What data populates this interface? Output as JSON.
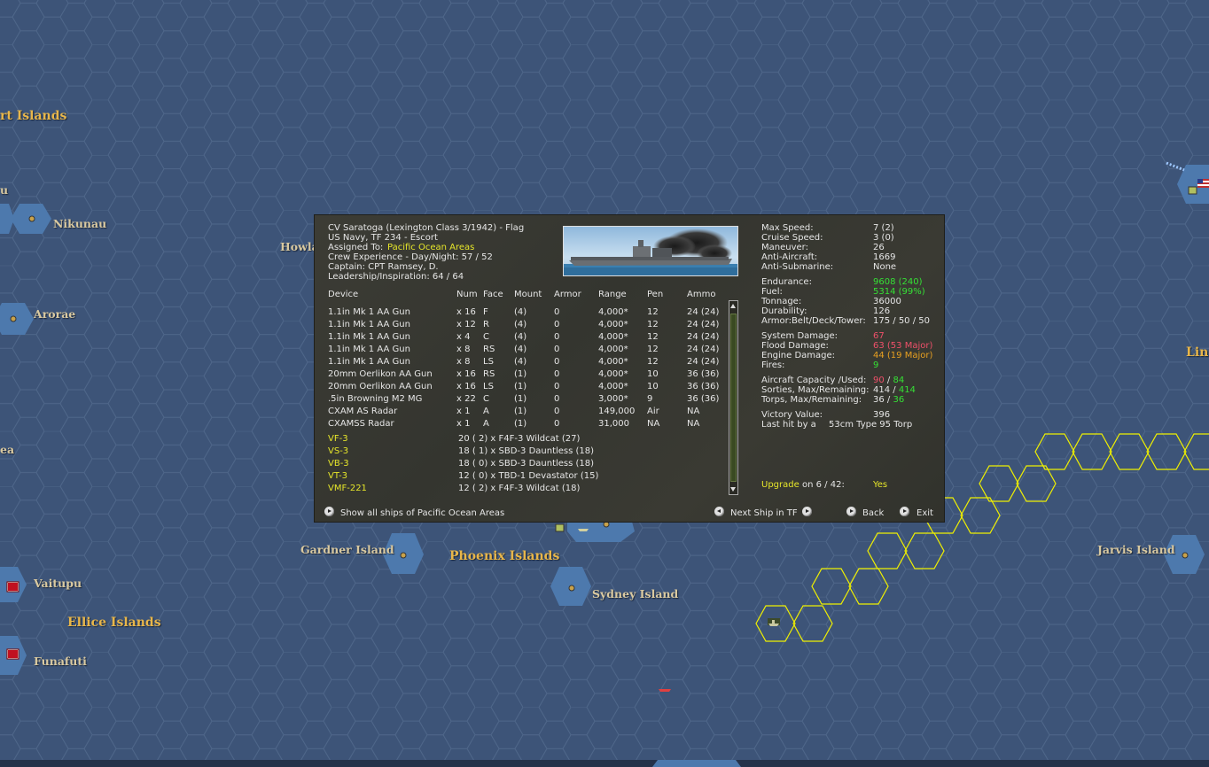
{
  "map": {
    "labels": {
      "islands_top": "rt Islands",
      "nikunau": "Nikunau",
      "howland": "Howla",
      "arorae": "Arorae",
      "left_u": "u",
      "left_ea": "ea",
      "gardner": "Gardner Island",
      "phoenix": "Phoenix Islands",
      "sydney": "Sydney Island",
      "jarvis": "Jarvis Island",
      "line": "Line",
      "vaitupu": "Vaitupu",
      "ellice": "Ellice Islands",
      "funafuti": "Funafuti"
    },
    "colors": {
      "sea": "#3d5478",
      "hex_line": "#4d6588",
      "island": "#5aa0c8",
      "route": "#f0f000"
    }
  },
  "ship": {
    "title": "CV Saratoga (Lexington Class 3/1942)  - Flag",
    "navy_tf": "US Navy, TF 234 - Escort",
    "assigned_label": "Assigned To:",
    "assigned_value": "Pacific Ocean Areas",
    "crew_exp": "Crew Experience - Day/Night:  57 / 52",
    "captain": "Captain:  CPT Ramsey, D.",
    "leadership": "Leadership/Inspiration: 64 / 64"
  },
  "devices": {
    "headers": [
      "Device",
      "Num",
      "Face",
      "Mount",
      "Armor",
      "Range",
      "Pen",
      "Ammo"
    ],
    "rows": [
      [
        "1.1in Mk 1 AA Gun",
        "x 16",
        "F",
        "(4)",
        "0",
        "4,000*",
        "12",
        "24  (24)"
      ],
      [
        "1.1in Mk 1 AA Gun",
        "x 12",
        "R",
        "(4)",
        "0",
        "4,000*",
        "12",
        "24  (24)"
      ],
      [
        "1.1in Mk 1 AA Gun",
        "x 4",
        "C",
        "(4)",
        "0",
        "4,000*",
        "12",
        "24  (24)"
      ],
      [
        "1.1in Mk 1 AA Gun",
        "x 8",
        "RS",
        "(4)",
        "0",
        "4,000*",
        "12",
        "24  (24)"
      ],
      [
        "1.1in Mk 1 AA Gun",
        "x 8",
        "LS",
        "(4)",
        "0",
        "4,000*",
        "12",
        "24  (24)"
      ],
      [
        "20mm Oerlikon AA Gun",
        "x 16",
        "RS",
        "(1)",
        "0",
        "4,000*",
        "10",
        "36  (36)"
      ],
      [
        "20mm Oerlikon AA Gun",
        "x 16",
        "LS",
        "(1)",
        "0",
        "4,000*",
        "10",
        "36  (36)"
      ],
      [
        ".5in Browning M2 MG",
        "x 22",
        "C",
        "(1)",
        "0",
        "3,000*",
        "9",
        "36  (36)"
      ],
      [
        "CXAM AS Radar",
        "x 1",
        "A",
        "(1)",
        "0",
        "149,000",
        "Air",
        "NA"
      ],
      [
        "CXAMSS Radar",
        "x 1",
        "A",
        "(1)",
        "0",
        "31,000",
        "NA",
        "NA"
      ]
    ]
  },
  "squadrons": [
    {
      "name": "VF-3",
      "detail": "20 ( 2) x F4F-3 Wildcat (27)"
    },
    {
      "name": "VS-3",
      "detail": "18 ( 1) x SBD-3 Dauntless (18)"
    },
    {
      "name": "VB-3",
      "detail": "18 ( 0) x SBD-3 Dauntless (18)"
    },
    {
      "name": "VT-3",
      "detail": "12 ( 0) x TBD-1 Devastator (15)"
    },
    {
      "name": "VMF-221",
      "detail": "12 ( 2) x F4F-3 Wildcat (18)"
    }
  ],
  "stats": {
    "max_speed_l": "Max Speed:",
    "max_speed_v": "7  (2)",
    "cruise_l": "Cruise Speed:",
    "cruise_v": "3  (0)",
    "maneuver_l": "Maneuver:",
    "maneuver_v": "26",
    "aa_l": "Anti-Aircraft:",
    "aa_v": "1669",
    "asw_l": "Anti-Submarine:",
    "asw_v": "None",
    "endurance_l": "Endurance:",
    "endurance_v": "9608  (240)",
    "fuel_l": "Fuel:",
    "fuel_v": "5314  (99%)",
    "tonnage_l": "Tonnage:",
    "tonnage_v": "36000",
    "durability_l": "Durability:",
    "durability_v": "126",
    "armor_l": "Armor:Belt/Deck/Tower:",
    "armor_v": "175 / 50 / 50",
    "sysdmg_l": "System Damage:",
    "sysdmg_v": "67",
    "flood_l": "Flood Damage:",
    "flood_v": "63   (53 Major)",
    "engine_l": "Engine Damage:",
    "engine_v": "44   (19 Major)",
    "fires_l": "Fires:",
    "fires_v": "9",
    "aircap_l": "Aircraft Capacity /Used:",
    "aircap_a": "90",
    "aircap_sep": " / ",
    "aircap_b": "84",
    "sorties_l": "Sorties, Max/Remaining:",
    "sorties_a": "414",
    "sorties_sep": " / ",
    "sorties_b": "414",
    "torps_l": "Torps, Max/Remaining:",
    "torps_a": "36",
    "torps_sep": " / ",
    "torps_b": "36",
    "victory_l": "Victory Value:",
    "victory_v": "396",
    "lasthit_l": "Last hit by a",
    "lasthit_v": "53cm Type 95 Torp",
    "upgrade_l": "Upgrade",
    "upgrade_on": "on 6 / 42:",
    "upgrade_v": "Yes"
  },
  "footer": {
    "show_all": "Show all ships of Pacific Ocean Areas",
    "next_ship": "Next Ship in TF",
    "back": "Back",
    "exit": "Exit"
  }
}
